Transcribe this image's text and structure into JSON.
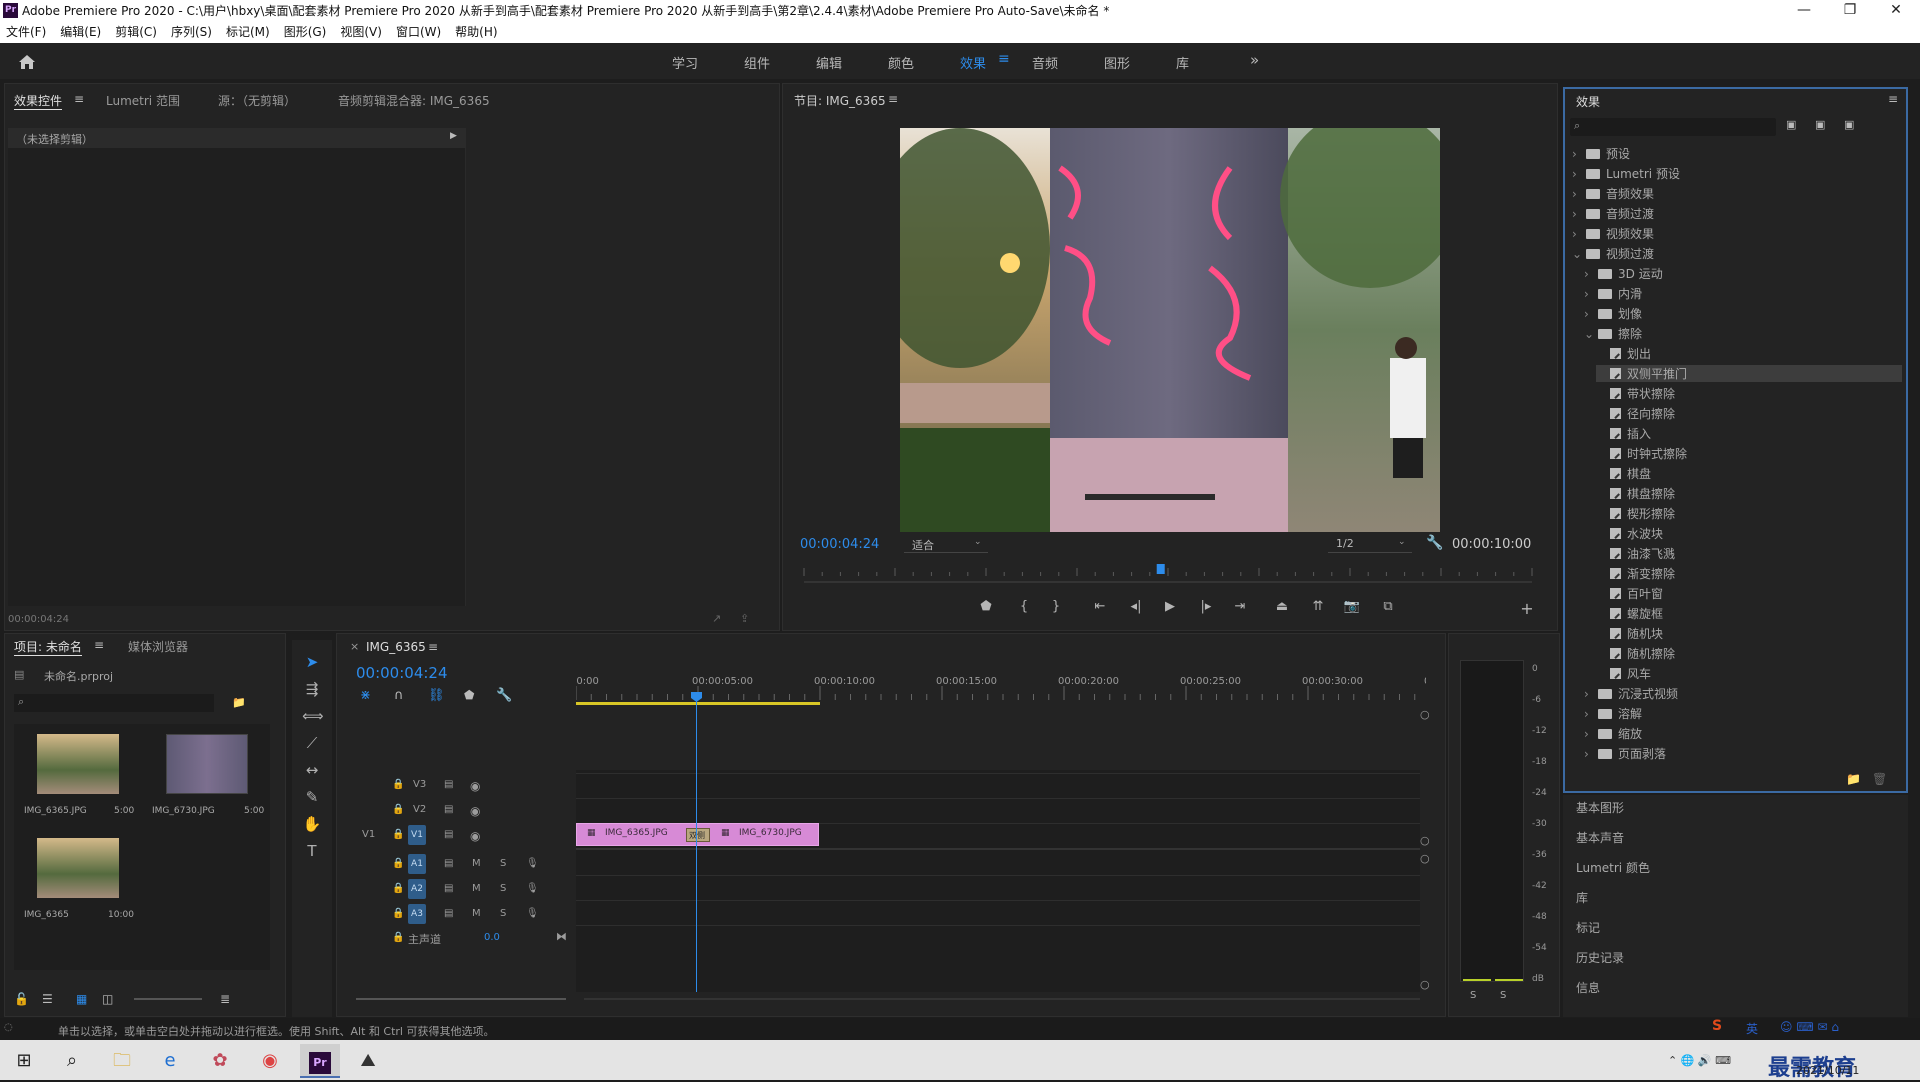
{
  "window": {
    "title": "Adobe Premiere Pro 2020 - C:\\用户\\hbxy\\桌面\\配套素材 Premiere Pro 2020 从新手到高手\\配套素材 Premiere Pro 2020 从新手到高手\\第2章\\2.4.4\\素材\\Adobe Premiere Pro Auto-Save\\未命名 *",
    "app_icon": "Pr"
  },
  "menu": [
    "文件(F)",
    "编辑(E)",
    "剪辑(C)",
    "序列(S)",
    "标记(M)",
    "图形(G)",
    "视图(V)",
    "窗口(W)",
    "帮助(H)"
  ],
  "workspaces": {
    "items": [
      "学习",
      "组件",
      "编辑",
      "颜色",
      "效果",
      "音频",
      "图形",
      "库"
    ],
    "active": "效果",
    "more": "»"
  },
  "source_panel": {
    "tabs": [
      "效果控件",
      "Lumetri 范围",
      "源：（无剪辑）",
      "音频剪辑混合器: IMG_6365"
    ],
    "no_clip": "（未选择剪辑）",
    "timecode": "00:00:04:24"
  },
  "program": {
    "title": "节目: IMG_6365",
    "timecode": "00:00:04:24",
    "fit": "适合",
    "quality": "1/2",
    "duration": "00:00:10:00",
    "playhead_fraction": 0.49
  },
  "effects": {
    "title": "效果",
    "tree": [
      {
        "label": "预设",
        "level": 0,
        "type": "folder",
        "open": false
      },
      {
        "label": "Lumetri 预设",
        "level": 0,
        "type": "folder",
        "open": false
      },
      {
        "label": "音频效果",
        "level": 0,
        "type": "folder",
        "open": false
      },
      {
        "label": "音频过渡",
        "level": 0,
        "type": "folder",
        "open": false
      },
      {
        "label": "视频效果",
        "level": 0,
        "type": "folder",
        "open": false
      },
      {
        "label": "视频过渡",
        "level": 0,
        "type": "folder",
        "open": true
      },
      {
        "label": "3D 运动",
        "level": 1,
        "type": "folder",
        "open": false
      },
      {
        "label": "内滑",
        "level": 1,
        "type": "folder",
        "open": false
      },
      {
        "label": "划像",
        "level": 1,
        "type": "folder",
        "open": false
      },
      {
        "label": "擦除",
        "level": 1,
        "type": "folder",
        "open": true
      },
      {
        "label": "划出",
        "level": 2,
        "type": "fx"
      },
      {
        "label": "双侧平推门",
        "level": 2,
        "type": "fx",
        "selected": true
      },
      {
        "label": "带状擦除",
        "level": 2,
        "type": "fx"
      },
      {
        "label": "径向擦除",
        "level": 2,
        "type": "fx"
      },
      {
        "label": "插入",
        "level": 2,
        "type": "fx"
      },
      {
        "label": "时钟式擦除",
        "level": 2,
        "type": "fx"
      },
      {
        "label": "棋盘",
        "level": 2,
        "type": "fx"
      },
      {
        "label": "棋盘擦除",
        "level": 2,
        "type": "fx"
      },
      {
        "label": "楔形擦除",
        "level": 2,
        "type": "fx"
      },
      {
        "label": "水波块",
        "level": 2,
        "type": "fx"
      },
      {
        "label": "油漆飞溅",
        "level": 2,
        "type": "fx"
      },
      {
        "label": "渐变擦除",
        "level": 2,
        "type": "fx"
      },
      {
        "label": "百叶窗",
        "level": 2,
        "type": "fx"
      },
      {
        "label": "螺旋框",
        "level": 2,
        "type": "fx"
      },
      {
        "label": "随机块",
        "level": 2,
        "type": "fx"
      },
      {
        "label": "随机擦除",
        "level": 2,
        "type": "fx"
      },
      {
        "label": "风车",
        "level": 2,
        "type": "fx"
      },
      {
        "label": "沉浸式视频",
        "level": 1,
        "type": "folder",
        "open": false
      },
      {
        "label": "溶解",
        "level": 1,
        "type": "folder",
        "open": false
      },
      {
        "label": "缩放",
        "level": 1,
        "type": "folder",
        "open": false
      },
      {
        "label": "页面剥落",
        "level": 1,
        "type": "folder",
        "open": false
      }
    ]
  },
  "side_panels": [
    "基本图形",
    "基本声音",
    "Lumetri 颜色",
    "库",
    "标记",
    "历史记录",
    "信息"
  ],
  "project": {
    "tabs": [
      "项目: 未命名",
      "媒体浏览器"
    ],
    "file": "未命名.prproj",
    "items": [
      {
        "name": "IMG_6365.JPG",
        "duration": "5:00"
      },
      {
        "name": "IMG_6730.JPG",
        "duration": "5:00"
      },
      {
        "name": "IMG_6365",
        "duration": "10:00"
      }
    ]
  },
  "timeline": {
    "tab": "IMG_6365",
    "timecode": "00:00:04:24",
    "ruler": [
      "00:00",
      "00:00:05:00",
      "00:00:10:00",
      "00:00:15:00",
      "00:00:20:00",
      "00:00:25:00",
      "00:00:30:00",
      "00:"
    ],
    "video_tracks": [
      "V3",
      "V2",
      "V1"
    ],
    "audio_tracks": [
      "A1",
      "A2",
      "A3"
    ],
    "source_patch": "V1",
    "master": "主声道",
    "master_value": "0.0",
    "clips": [
      {
        "label": "IMG_6365.JPG"
      },
      {
        "label": "IMG_6730.JPG"
      }
    ],
    "transition": "双侧"
  },
  "meter": {
    "scale": [
      "0",
      "-6",
      "-12",
      "-18",
      "-24",
      "-30",
      "-36",
      "-42",
      "-48",
      "-54",
      "dB"
    ],
    "solo": [
      "S",
      "S"
    ]
  },
  "status": "单击以选择，或单击空白处并拖动以进行框选。使用 Shift、Alt 和 Ctrl 可获得其他选项。",
  "taskbar": {
    "date": "2021/10/11",
    "watermark": "最需教育",
    "ime": "英"
  }
}
